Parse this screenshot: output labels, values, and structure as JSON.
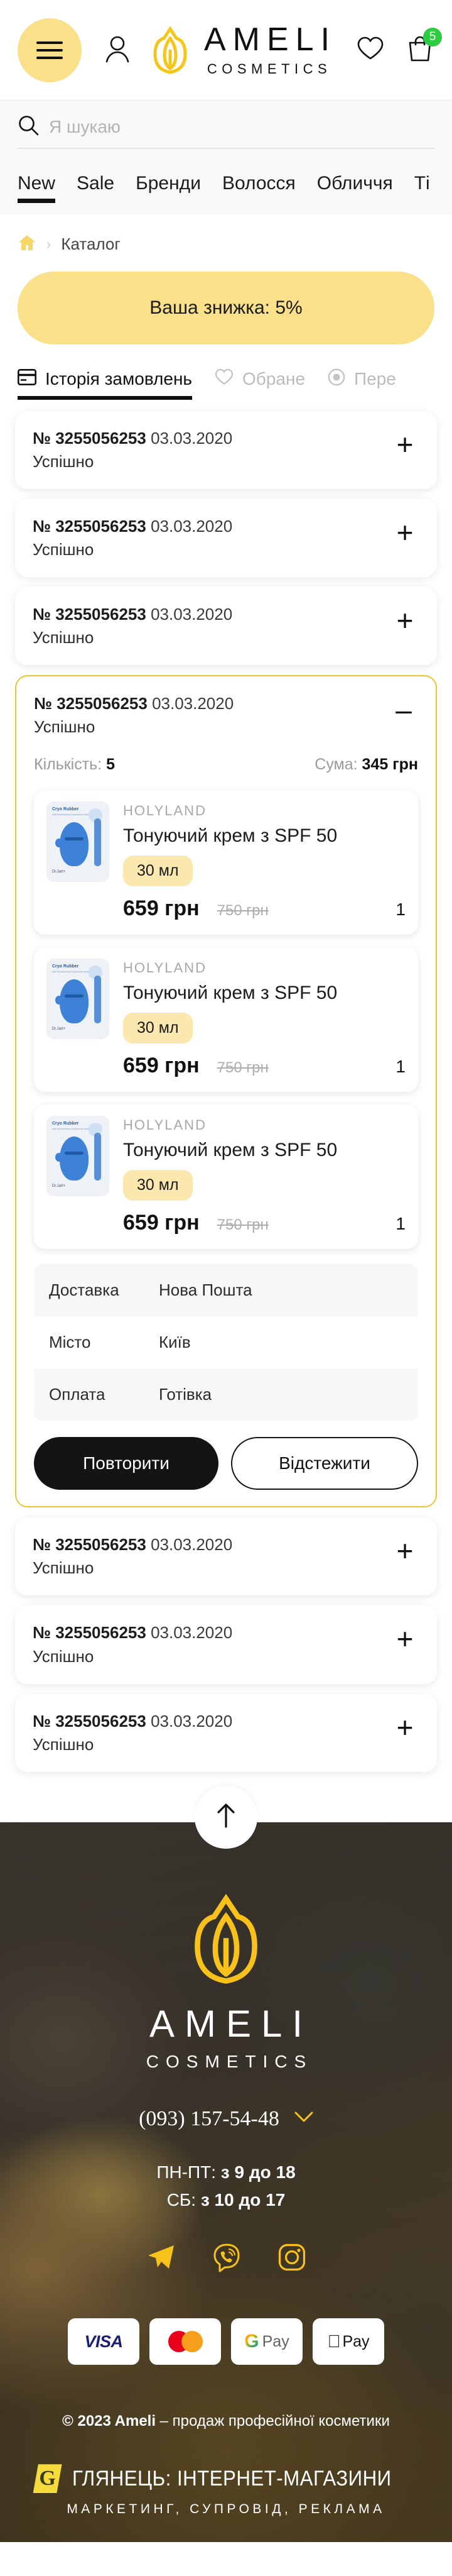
{
  "header": {
    "menu_icon": "burger-menu-icon",
    "account_icon": "user-icon",
    "logo_main": "AMELI",
    "logo_sub": "COSMETICS",
    "wishlist_icon": "heart-icon",
    "cart_icon": "bag-icon",
    "cart_count": "5"
  },
  "search": {
    "icon": "search-icon",
    "placeholder": "Я шукаю",
    "value": ""
  },
  "nav": {
    "items": [
      {
        "label": "New",
        "active": true
      },
      {
        "label": "Sale",
        "active": false
      },
      {
        "label": "Бренди",
        "active": false
      },
      {
        "label": "Волосся",
        "active": false
      },
      {
        "label": "Обличчя",
        "active": false
      },
      {
        "label": "Ті",
        "active": false
      }
    ]
  },
  "breadcrumb": {
    "home_icon": "home-icon",
    "separator": "›",
    "current": "Каталог"
  },
  "discount": {
    "label": "Ваша знижка: 5%"
  },
  "tabs": [
    {
      "label": "Історія замовлень",
      "icon": "card-icon",
      "active": true
    },
    {
      "label": "Обране",
      "icon": "heart-icon",
      "active": false
    },
    {
      "label": "Пере",
      "icon": "eye-icon",
      "active": false
    }
  ],
  "orders_before": [
    {
      "number_label": "№",
      "number": "3255056253",
      "date": "03.03.2020",
      "status": "Успішно",
      "toggle": "+"
    },
    {
      "number_label": "№",
      "number": "3255056253",
      "date": "03.03.2020",
      "status": "Успішно",
      "toggle": "+"
    },
    {
      "number_label": "№",
      "number": "3255056253",
      "date": "03.03.2020",
      "status": "Успішно",
      "toggle": "+"
    }
  ],
  "expanded_order": {
    "number_label": "№",
    "number": "3255056253",
    "date": "03.03.2020",
    "status": "Успішно",
    "toggle": "–",
    "qty_label": "Кількість:",
    "qty_value": "5",
    "sum_label": "Сума:",
    "sum_value": "345 грн",
    "products": [
      {
        "brand": "HOLYLAND",
        "title": "Тонуючий крем з SPF 50",
        "volume": "30 мл",
        "price": "659 грн",
        "old_price": "750 грн",
        "qty": "1",
        "image_pack_label": "Cryo Rubber",
        "image_pack_sub": "with Moisturizing Hyaluronic Acid",
        "image_brand": "Dr.Jart+"
      },
      {
        "brand": "HOLYLAND",
        "title": "Тонуючий крем з SPF 50",
        "volume": "30 мл",
        "price": "659 грн",
        "old_price": "750 грн",
        "qty": "1",
        "image_pack_label": "Cryo Rubber",
        "image_pack_sub": "with Moisturizing Hyaluronic Acid",
        "image_brand": "Dr.Jart+"
      },
      {
        "brand": "HOLYLAND",
        "title": "Тонуючий крем з SPF 50",
        "volume": "30 мл",
        "price": "659 грн",
        "old_price": "750 грн",
        "qty": "1",
        "image_pack_label": "Cryo Rubber",
        "image_pack_sub": "with Moisturizing Hyaluronic Acid",
        "image_brand": "Dr.Jart+"
      }
    ],
    "info": [
      {
        "key": "Доставка",
        "value": "Нова Пошта"
      },
      {
        "key": "Місто",
        "value": "Київ"
      },
      {
        "key": "Оплата",
        "value": "Готівка"
      }
    ],
    "repeat_button": "Повторити",
    "track_button": "Відстежити"
  },
  "orders_after": [
    {
      "number_label": "№",
      "number": "3255056253",
      "date": "03.03.2020",
      "status": "Успішно",
      "toggle": "+"
    },
    {
      "number_label": "№",
      "number": "3255056253",
      "date": "03.03.2020",
      "status": "Успішно",
      "toggle": "+"
    },
    {
      "number_label": "№",
      "number": "3255056253",
      "date": "03.03.2020",
      "status": "Успішно",
      "toggle": "+"
    }
  ],
  "scroll_top": {
    "icon": "arrow-up-icon"
  },
  "footer": {
    "logo_main": "AMELI",
    "logo_sub": "COSMETICS",
    "phone": "(093) 157-54-48",
    "phone_chevron": "chevron-down-icon",
    "hours_weekday_label": "ПН-ПТ:",
    "hours_weekday_value": "з 9 до 18",
    "hours_saturday_label": "СБ:",
    "hours_saturday_value": "з 10 до 17",
    "social": [
      {
        "name": "telegram-icon"
      },
      {
        "name": "viber-icon"
      },
      {
        "name": "instagram-icon"
      }
    ],
    "payments": [
      {
        "name": "visa-logo",
        "label": "VISA"
      },
      {
        "name": "mastercard-logo",
        "label": ""
      },
      {
        "name": "google-pay-logo",
        "label": "Pay"
      },
      {
        "name": "apple-pay-logo",
        "label": "Pay"
      }
    ],
    "copyright_bold": "© 2023 Ameli",
    "copyright_rest": " – продаж професійної косметики",
    "dev_logo": "G",
    "dev_title": "ГЛЯНЕЦЬ: ІНТЕРНЕТ-МАГАЗИНИ",
    "dev_sub": "МАРКЕТИНГ, СУПРОВІД, РЕКЛАМА"
  },
  "colors": {
    "accent_yellow": "#FBE08A",
    "brand_gold": "#F5C518",
    "cart_badge_green": "#2ECC40",
    "expanded_border": "#F0C330"
  }
}
